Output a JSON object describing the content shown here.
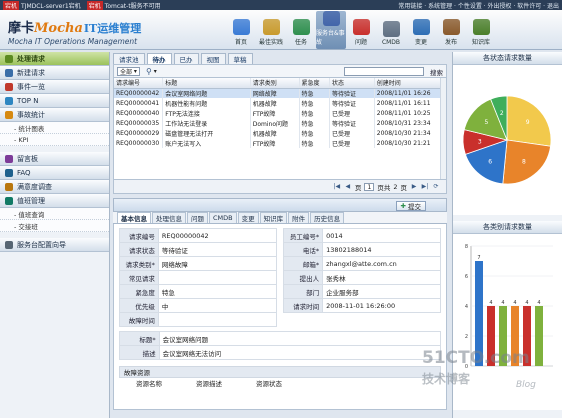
{
  "topbar": {
    "alerts": [
      {
        "badge": "宕机",
        "text": "TJMDCL-server1宕机"
      },
      {
        "badge": "宕机",
        "text": "Tomcat-t服务不可用"
      }
    ],
    "links": "常用链接 · 系统管理 · 个性设置 · 外出授权 · 软件许可 · 退出"
  },
  "header": {
    "logo_brand": "摩卡",
    "logo_latin": "Mocha",
    "logo_cn": "IT运维管理",
    "logo_sub": "Mocha IT Operations Management",
    "nav": [
      {
        "label": "首页",
        "icon": "home-icon",
        "color": "#3a7bd5"
      },
      {
        "label": "最佳实践",
        "icon": "best-practice-icon",
        "color": "#c99b2d"
      },
      {
        "label": "任务",
        "icon": "task-icon",
        "color": "#2f8f4e"
      },
      {
        "label": "服务台&事故",
        "icon": "service-desk-icon",
        "color": "#4466aa"
      },
      {
        "label": "问题",
        "icon": "question-icon",
        "color": "#c9302c"
      },
      {
        "label": "CMDB",
        "icon": "cmdb-icon",
        "color": "#5f6f82"
      },
      {
        "label": "变更",
        "icon": "change-icon",
        "color": "#2e6eb5"
      },
      {
        "label": "发布",
        "icon": "release-icon",
        "color": "#8a5a2b"
      },
      {
        "label": "知识库",
        "icon": "knowledge-icon",
        "color": "#4b7f2a"
      }
    ],
    "active_nav": 3
  },
  "sidebar": {
    "items": [
      {
        "label": "处理请求",
        "type": "head",
        "active": true,
        "icon": "process-request-icon",
        "color": "#5b8a21"
      },
      {
        "label": "新建请求",
        "type": "head",
        "icon": "new-request-icon",
        "color": "#3a6ea8"
      },
      {
        "label": "事件一览",
        "type": "head",
        "icon": "event-list-icon",
        "color": "#c0392b"
      },
      {
        "label": "TOP N",
        "type": "head",
        "icon": "topn-icon",
        "color": "#2e86c1"
      },
      {
        "label": "事故统计",
        "type": "head",
        "icon": "statistics-icon",
        "color": "#d68910"
      },
      {
        "label": "- 统计图表",
        "type": "sub"
      },
      {
        "label": "- KPI",
        "type": "sub"
      },
      {
        "label": "留言板",
        "type": "head",
        "gap": true,
        "icon": "message-board-icon",
        "color": "#7d3c98"
      },
      {
        "label": "FAQ",
        "type": "head",
        "icon": "faq-icon",
        "color": "#1f618d"
      },
      {
        "label": "满意度调查",
        "type": "head",
        "icon": "survey-icon",
        "color": "#b9770e"
      },
      {
        "label": "值班管理",
        "type": "head",
        "icon": "duty-icon",
        "color": "#117a65"
      },
      {
        "label": "- 值班查询",
        "type": "sub"
      },
      {
        "label": "- 交接班",
        "type": "sub"
      },
      {
        "label": "服务台配置向导",
        "type": "head",
        "gap": true,
        "icon": "wizard-icon",
        "color": "#566573"
      }
    ]
  },
  "center": {
    "tabs": [
      "请求池",
      "待办",
      "已办",
      "视图",
      "草稿"
    ],
    "active_tab": 1,
    "filter_value": "全部",
    "search_label": "搜索",
    "columns": [
      "请求编号",
      "标题",
      "请求类别",
      "紧急度",
      "状态",
      "创建时间"
    ],
    "rows": [
      [
        "REQ00000042",
        "会议室网络问题",
        "网络故障",
        "特急",
        "等待验证",
        "2008/11/01 16:26"
      ],
      [
        "REQ00000041",
        "机器性能有问题",
        "机器故障",
        "特急",
        "等待验证",
        "2008/11/01 16:11"
      ],
      [
        "REQ00000040",
        "FTP无法连接",
        "FTP故障",
        "特急",
        "已受理",
        "2008/11/01 10:25"
      ],
      [
        "REQ00000035",
        "工作站无法登录",
        "Domino问题",
        "特急",
        "等待验证",
        "2008/10/31 23:34"
      ],
      [
        "REQ00000029",
        "磁盘管理无法打开",
        "机器故障",
        "特急",
        "已受理",
        "2008/10/30 21:34"
      ],
      [
        "REQ00000030",
        "账户无法写入",
        "FTP故障",
        "特急",
        "已受理",
        "2008/10/30 21:21"
      ]
    ],
    "selected_row": 0,
    "pager": {
      "page_label": "页",
      "page": "1",
      "of_label": "页共",
      "total": "2",
      "suffix": "页"
    },
    "submit_label": "提交",
    "detail_tabs": [
      "基本信息",
      "处理信息",
      "问题",
      "CMDB",
      "变更",
      "知识库",
      "附件",
      "历史信息"
    ],
    "active_detail_tab": 0,
    "form_left": [
      {
        "label": "请求编号",
        "value": "REQ00000042"
      },
      {
        "label": "请求状态",
        "value": "等待验证"
      },
      {
        "label": "请求类别*",
        "value": "网络故障"
      },
      {
        "label": "常见请求",
        "value": ""
      },
      {
        "label": "紧急度",
        "value": "特急"
      },
      {
        "label": "优先级",
        "value": "中"
      },
      {
        "label": "故障时间",
        "value": ""
      }
    ],
    "form_right": [
      {
        "label": "员工编号*",
        "value": "0014"
      },
      {
        "label": "电话*",
        "value": "13802188014"
      },
      {
        "label": "邮箱*",
        "value": "zhangxl@atte.com.cn"
      },
      {
        "label": "提出人",
        "value": "张秀林"
      },
      {
        "label": "部门",
        "value": "企业服务部"
      },
      {
        "label": "请求时间",
        "value": "2008-11-01 16:26:00"
      }
    ],
    "title_label": "标题*",
    "title_value": "会议室网络问题",
    "desc_label": "描述",
    "desc_value": "会议室网络无法访问",
    "resource_section": "故障资源",
    "resource_columns": [
      "资源名称",
      "资源描述",
      "资源状态"
    ]
  },
  "right": {
    "panel1_title": "各状态请求数量",
    "panel2_title": "各类别请求数量"
  },
  "chart_data": [
    {
      "type": "pie",
      "title": "各状态请求数量",
      "values": [
        9,
        8,
        6,
        3,
        5,
        2
      ],
      "colors": [
        "#f2c94c",
        "#e8842a",
        "#2e74c9",
        "#c9302c",
        "#7fb13d",
        "#3fae5b"
      ]
    },
    {
      "type": "bar",
      "title": "各类别请求数量",
      "values": [
        7,
        4,
        4,
        4,
        4,
        4
      ],
      "ylim": [
        0,
        8
      ],
      "colors": [
        "#2e74c9",
        "#c9302c",
        "#7fb13d",
        "#e8842a",
        "#c9302c",
        "#7fb13d"
      ]
    }
  ],
  "watermark": {
    "line1": "51CTO.com",
    "line2": "技术博客",
    "line3": "Blog"
  }
}
